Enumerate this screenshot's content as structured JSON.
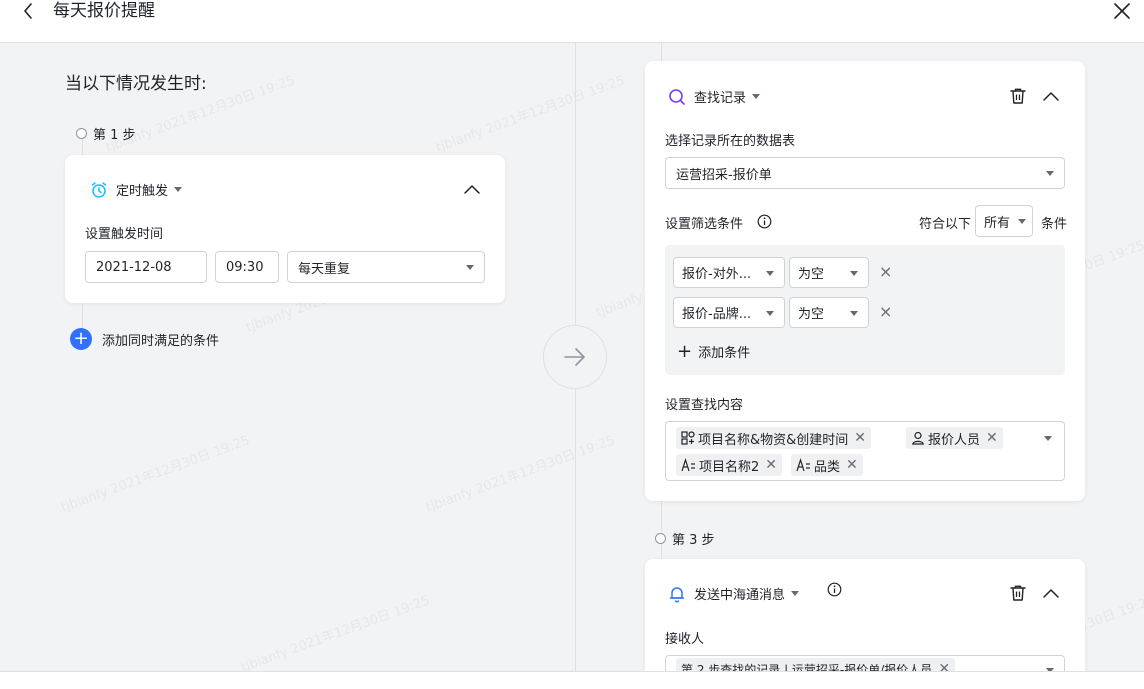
{
  "header": {
    "title": "每天报价提醒"
  },
  "watermark": "tjbianfy 2021年12月30日 19:25",
  "trigger_section": {
    "title": "当以下情况发生时:",
    "step1_label": "第 1 步",
    "card": {
      "type_label": "定时触发",
      "time_label": "设置触发时间",
      "date_value": "2021-12-08",
      "time_value": "09:30",
      "repeat_value": "每天重复"
    },
    "add_condition_label": "添加同时满足的条件"
  },
  "action_section": {
    "find_card": {
      "type_label": "查找记录",
      "table_label": "选择记录所在的数据表",
      "table_value": "运营招采-报价单",
      "filter_label": "设置筛选条件",
      "match_prefix": "符合以下",
      "match_value": "所有",
      "match_suffix": "条件",
      "filters": [
        {
          "field": "报价-对外...",
          "op": "为空"
        },
        {
          "field": "报价-品牌...",
          "op": "为空"
        }
      ],
      "add_filter_label": "添加条件",
      "content_label": "设置查找内容",
      "tags": [
        {
          "label": "项目名称&物资&创建时间",
          "icon": "formula-icon"
        },
        {
          "label": "报价人员",
          "icon": "person-icon"
        },
        {
          "label": "项目名称2",
          "icon": "text-field-icon"
        },
        {
          "label": "品类",
          "icon": "text-field-icon"
        }
      ]
    },
    "step3_label": "第 3 步",
    "notify_card": {
      "type_label": "发送中海通消息",
      "receiver_label": "接收人",
      "receiver_value": "第 2 步查找的记录 | 运营招采-报价单/报价人员"
    }
  }
}
